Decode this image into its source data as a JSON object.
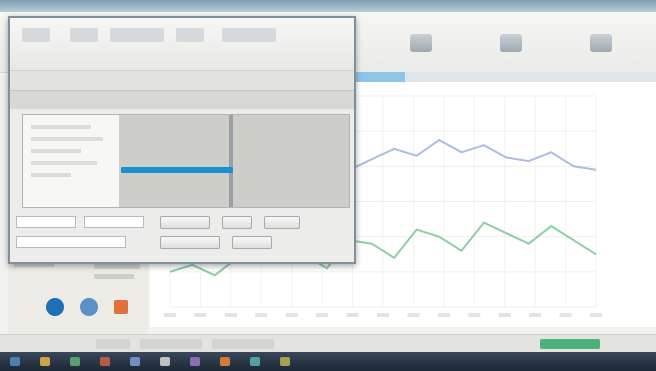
{
  "colors": {
    "accent_blue": "#1b8fd0",
    "series_green": "#79c596",
    "series_blue": "#9fb0dd",
    "taskbar": "#2a3646"
  },
  "icons": [
    "blue-globe-icon",
    "settings-icon",
    "orange-app-icon"
  ],
  "chart_data": {
    "type": "line",
    "title": "",
    "xlabel": "",
    "ylabel": "",
    "series": [
      {
        "values": [
          62,
          66,
          64,
          70,
          72,
          69,
          75,
          80,
          78,
          84,
          90,
          86,
          95,
          88,
          92,
          85,
          83,
          88,
          80,
          78
        ]
      },
      {
        "values": [
          20,
          24,
          18,
          28,
          26,
          34,
          30,
          22,
          38,
          36,
          28,
          44,
          40,
          32,
          48,
          42,
          36,
          46,
          38,
          30
        ]
      }
    ],
    "ylim": [
      0,
      120
    ],
    "grid": true
  }
}
